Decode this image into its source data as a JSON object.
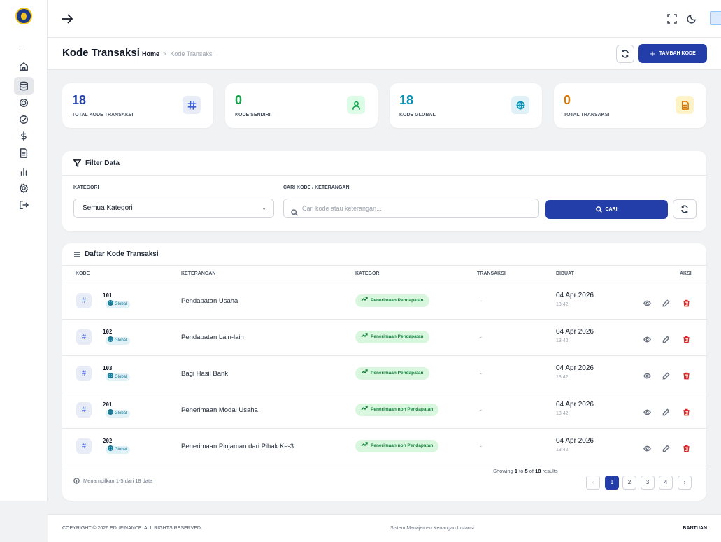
{
  "breadcrumb": {
    "title": "Kode Transaksi",
    "home": "Home",
    "sep": ">",
    "current": "Kode Transaksi"
  },
  "header": {
    "add_label": "TAMBAH KODE",
    "add_plus": "+"
  },
  "stats": [
    {
      "value": "18",
      "label": "TOTAL KODE TRANSAKSI",
      "icon": "hash-icon",
      "color": "#3b5bd9"
    },
    {
      "value": "0",
      "label": "KODE SENDIRI",
      "icon": "user-icon",
      "color": "#16a34a"
    },
    {
      "value": "18",
      "label": "KODE GLOBAL",
      "icon": "globe-icon",
      "color": "#0891b2"
    },
    {
      "value": "0",
      "label": "TOTAL TRANSAKSI",
      "icon": "file-icon",
      "color": "#d97706"
    }
  ],
  "filter": {
    "title": "Filter Data",
    "kategori_label": "KATEGORI",
    "kategori_value": "Semua Kategori",
    "search_label": "CARI KODE / KETERANGAN",
    "search_placeholder": "Cari kode atau keterangan...",
    "search_button": "CARI"
  },
  "list": {
    "title": "Daftar Kode Transaksi",
    "columns": [
      "KODE",
      "KETERANGAN",
      "KATEGORI",
      "TRANSAKSI",
      "DIBUAT",
      "AKSI"
    ],
    "rows": [
      {
        "kode": "101",
        "scope": "Global",
        "keterangan": "Pendapatan Usaha",
        "kategori": "Penerimaan Pendapatan",
        "transaksi": "-",
        "date": "04 Apr 2026",
        "time": "13:42"
      },
      {
        "kode": "102",
        "scope": "Global",
        "keterangan": "Pendapatan Lain-lain",
        "kategori": "Penerimaan Pendapatan",
        "transaksi": "-",
        "date": "04 Apr 2026",
        "time": "13:42"
      },
      {
        "kode": "103",
        "scope": "Global",
        "keterangan": "Bagi Hasil Bank",
        "kategori": "Penerimaan Pendapatan",
        "transaksi": "-",
        "date": "04 Apr 2026",
        "time": "13:42"
      },
      {
        "kode": "201",
        "scope": "Global",
        "keterangan": "Penerimaan Modal Usaha",
        "kategori": "Penerimaan non Pendapatan",
        "transaksi": "-",
        "date": "04 Apr 2026",
        "time": "13:42"
      },
      {
        "kode": "202",
        "scope": "Global",
        "keterangan": "Penerimaan Pinjaman dari Pihak Ke-3",
        "kategori": "Penerimaan non Pendapatan",
        "transaksi": "-",
        "date": "04 Apr 2026",
        "time": "13:42"
      }
    ],
    "info": "Menampilkan 1-5 dari 18 data",
    "showing_pre": "Showing",
    "showing_from": "1",
    "showing_to_word": "to",
    "showing_to": "5",
    "showing_of_word": "of",
    "showing_total": "18",
    "showing_post": "results"
  },
  "pagination": {
    "prev": "‹",
    "pages": [
      "1",
      "2",
      "3",
      "4"
    ],
    "next": "›",
    "current": "1"
  },
  "footer": {
    "copyright": "COPYRIGHT © 2026 EDUFINANCE. ALL RIGHTS RESERVED.",
    "center": "Sistem Manajemen Keuangan Instansi",
    "help": "BANTUAN"
  },
  "sidebar": {
    "more": "..."
  }
}
